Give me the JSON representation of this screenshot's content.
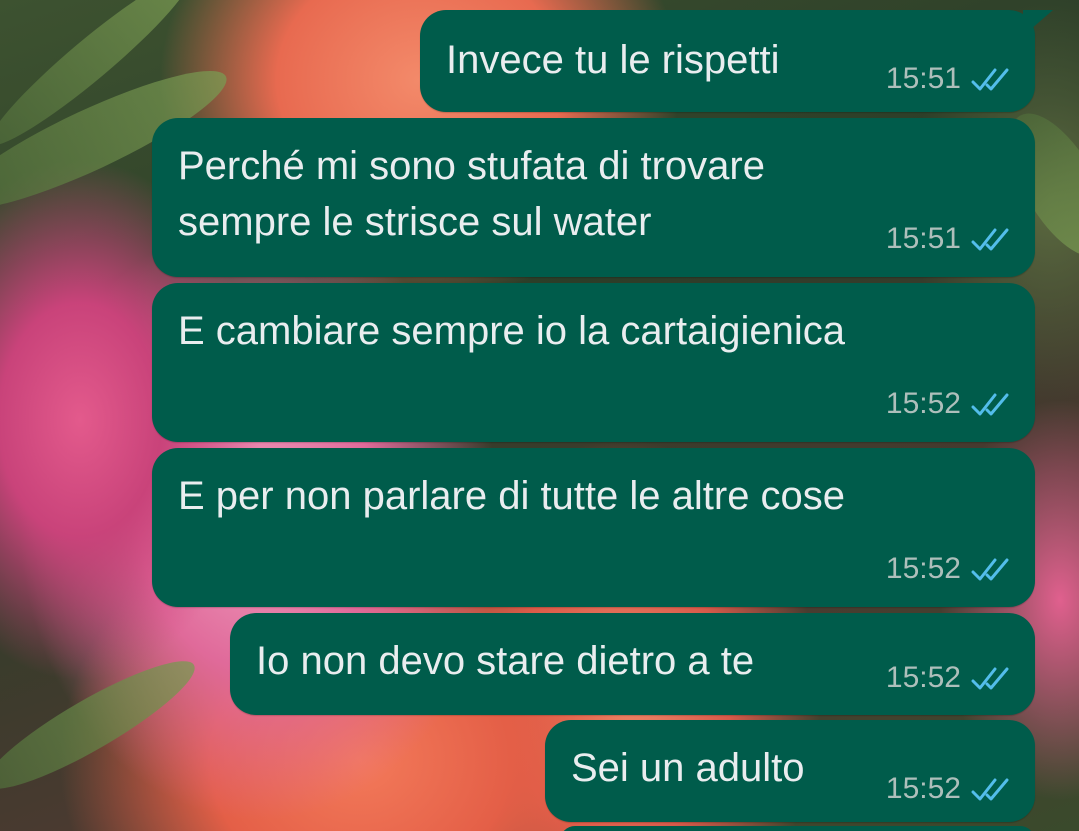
{
  "messages": [
    {
      "text": "Invece tu le rispetti",
      "time": "15:51",
      "status_icon": "double-check-read-icon"
    },
    {
      "text": "Perché mi sono stufata di trovare\nsempre le strisce sul water",
      "time": "15:51",
      "status_icon": "double-check-read-icon"
    },
    {
      "text": "E cambiare sempre io la cartaigienica",
      "time": "15:52",
      "status_icon": "double-check-read-icon"
    },
    {
      "text": "E per non parlare di tutte le altre cose",
      "time": "15:52",
      "status_icon": "double-check-read-icon"
    },
    {
      "text": "Io non devo stare dietro a te",
      "time": "15:52",
      "status_icon": "double-check-read-icon"
    },
    {
      "text": "Sei un adulto",
      "time": "15:52",
      "status_icon": "double-check-read-icon"
    }
  ],
  "colors": {
    "bubble_outgoing": "#005c4b",
    "message_text": "#e9edef",
    "meta_text": "#aebfbb",
    "read_check": "#53bdeb"
  }
}
